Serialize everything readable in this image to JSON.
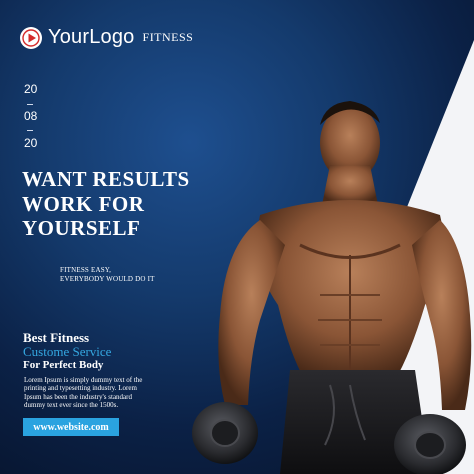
{
  "brand": {
    "logo_text": "YourLogo",
    "logo_sub": "FITNESS",
    "logo_icon": "play-icon"
  },
  "date": {
    "day": "20",
    "month": "08",
    "year": "20"
  },
  "headline": {
    "line1": "WANT RESULTS",
    "line2": "WORK FOR",
    "line3": "YOURSELF"
  },
  "tagline": {
    "line1": "FITNESS EASY,",
    "line2": "EVERYBODY WOULD DO IT"
  },
  "service": {
    "title": "Best Fitness",
    "subtitle": "Custome Service",
    "tag": "For Perfect Body"
  },
  "body_text": "Lorem Ipsum is simply dummy text of the printing and typesetting industry. Lorem Ipsum has been the industry's standard dummy text ever since the 1500s.",
  "website": "www.website.com",
  "colors": {
    "background": "#143a6c",
    "accent": "#34a7e0",
    "button": "#2aa3e0",
    "logo_red": "#d42b2b"
  }
}
